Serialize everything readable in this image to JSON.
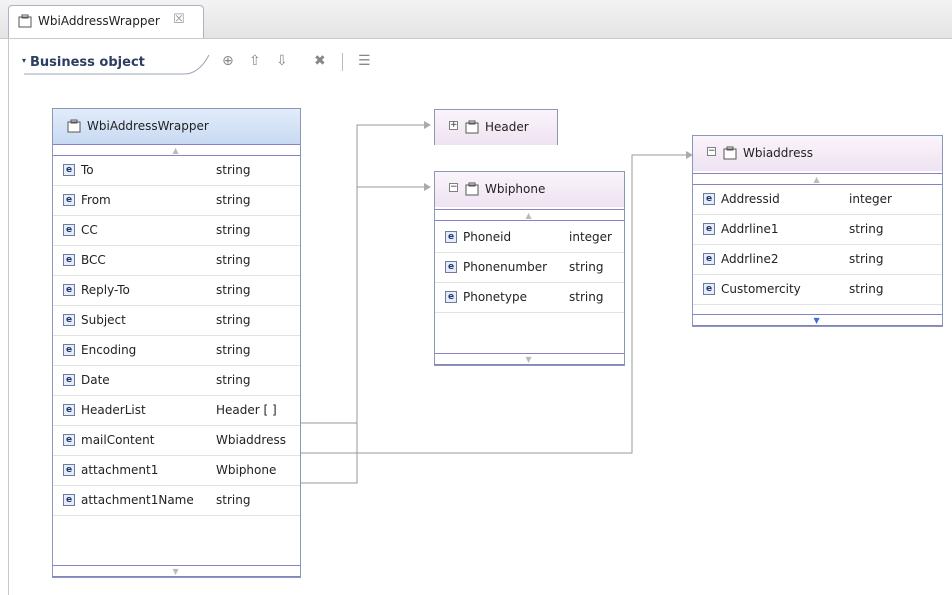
{
  "tab": {
    "title": "WbiAddressWrapper",
    "close_glyph": "☒"
  },
  "section": {
    "title": "Business object",
    "toolbar": {
      "add_glyph": "⊕",
      "up_glyph": "⇧",
      "down_glyph": "⇩",
      "delete_glyph": "✖",
      "layout_glyph": "☰"
    }
  },
  "wrapper": {
    "name": "WbiAddressWrapper",
    "fields": [
      {
        "name": "To",
        "type": "string"
      },
      {
        "name": "From",
        "type": "string"
      },
      {
        "name": "CC",
        "type": "string"
      },
      {
        "name": "BCC",
        "type": "string"
      },
      {
        "name": "Reply-To",
        "type": "string"
      },
      {
        "name": "Subject",
        "type": "string"
      },
      {
        "name": "Encoding",
        "type": "string"
      },
      {
        "name": "Date",
        "type": "string"
      },
      {
        "name": "HeaderList",
        "type": "Header [ ]"
      },
      {
        "name": "mailContent",
        "type": "Wbiaddress"
      },
      {
        "name": "attachment1",
        "type": "Wbiphone"
      },
      {
        "name": "attachment1Name",
        "type": "string"
      }
    ]
  },
  "header_bo": {
    "name": "Header",
    "toggle": "⊞"
  },
  "wbiphone": {
    "name": "Wbiphone",
    "toggle": "⊟",
    "fields": [
      {
        "name": "Phoneid",
        "type": "integer"
      },
      {
        "name": "Phonenumber",
        "type": "string"
      },
      {
        "name": "Phonetype",
        "type": "string"
      }
    ]
  },
  "wbiaddress": {
    "name": "Wbiaddress",
    "toggle": "⊟",
    "fields": [
      {
        "name": "Addressid",
        "type": "integer"
      },
      {
        "name": "Addrline1",
        "type": "string"
      },
      {
        "name": "Addrline2",
        "type": "string"
      },
      {
        "name": "Customercity",
        "type": "string"
      }
    ]
  },
  "element_glyph": "e",
  "scroll": {
    "up": "▲",
    "down": "▼"
  }
}
